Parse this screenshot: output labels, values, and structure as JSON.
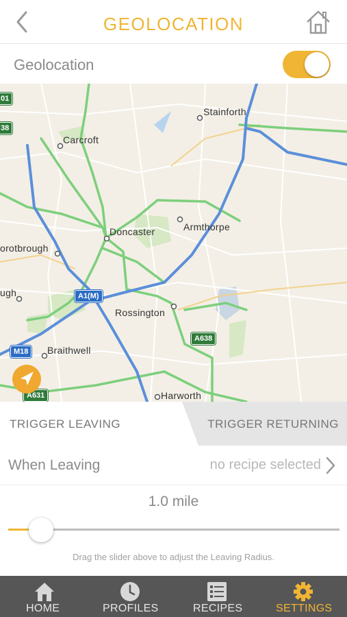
{
  "header": {
    "title": "GEOLOCATION",
    "back_icon": "chevron-left-icon",
    "home_icon": "house-icon",
    "accent_color": "#f0b534"
  },
  "geolocation_toggle": {
    "label": "Geolocation",
    "state": "on"
  },
  "map": {
    "places": [
      "Stainforth",
      "Carcroft",
      "Doncaster",
      "Armthorpe",
      "orotbrough",
      "ugh",
      "Rossington",
      "Braithwell",
      "Harworth"
    ],
    "road_shields": [
      "01",
      "38",
      "A1(M)",
      "A638",
      "M18",
      "A631"
    ],
    "locate_icon": "location-arrow-icon"
  },
  "tabs": {
    "leaving": "TRIGGER LEAVING",
    "returning": "TRIGGER RETURNING",
    "active": "leaving"
  },
  "when_leaving": {
    "label": "When Leaving",
    "value": "no recipe selected"
  },
  "radius": {
    "text": "1.0 mile",
    "slider_fraction": 0.1,
    "hint": "Drag the slider above to adjust the Leaving Radius."
  },
  "tabbar": {
    "items": [
      {
        "label": "HOME",
        "icon": "house-icon"
      },
      {
        "label": "PROFILES",
        "icon": "clock-icon"
      },
      {
        "label": "RECIPES",
        "icon": "list-icon"
      },
      {
        "label": "SETTINGS",
        "icon": "gear-icon"
      }
    ],
    "active": "SETTINGS"
  }
}
